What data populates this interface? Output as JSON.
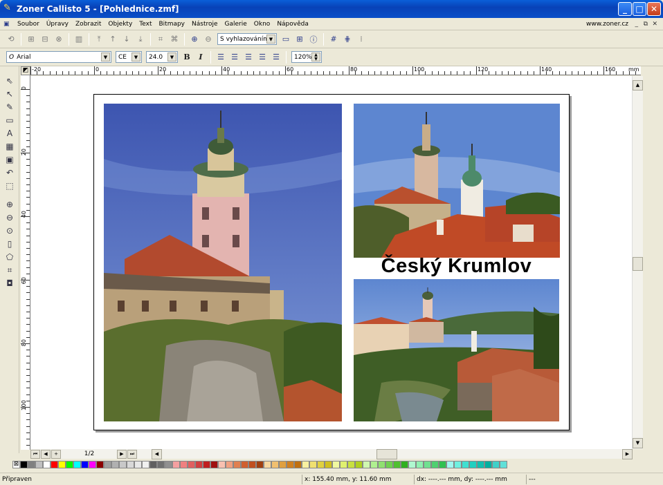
{
  "window": {
    "title": "Zoner Callisto 5 - [Pohlednice.zmf]"
  },
  "menu": {
    "items": [
      "Soubor",
      "Úpravy",
      "Zobrazit",
      "Objekty",
      "Text",
      "Bitmapy",
      "Nástroje",
      "Galerie",
      "Okno",
      "Nápověda"
    ],
    "site": "www.zoner.cz"
  },
  "toolbar": {
    "smoothing": "S vyhlazováním"
  },
  "format": {
    "font": "Arial",
    "charset": "CE",
    "size": "24.0",
    "bold": "B",
    "italic": "I",
    "zoom": "120%"
  },
  "ruler": {
    "h_labels": [
      "-20",
      "0",
      "20",
      "40",
      "60",
      "80",
      "100",
      "120",
      "140",
      "160"
    ],
    "h_unit": "mm",
    "v_labels": [
      "0",
      "20",
      "40",
      "60",
      "80",
      "100"
    ]
  },
  "document": {
    "title_text": "Český Krumlov"
  },
  "pagenav": {
    "page": "1/2"
  },
  "status": {
    "ready": "Připraven",
    "xy": "x: 155.40 mm, y: 11.60 mm",
    "dxdy": "dx: ----.--- mm, dy: ----.--- mm",
    "extra": "---"
  },
  "palette": [
    "#000000",
    "#808080",
    "#c0c0c0",
    "#ffffff",
    "#ff0000",
    "#ffff00",
    "#00ff00",
    "#00ffff",
    "#0000ff",
    "#ff00ff",
    "#8b0000",
    "#a0a0a0",
    "#b0b0b0",
    "#c8c8c8",
    "#d8d8d8",
    "#e8e8e8",
    "#f0f0f0",
    "#606060",
    "#707070",
    "#909090",
    "#f4a0a0",
    "#f08080",
    "#e06060",
    "#d04040",
    "#c02020",
    "#a01010",
    "#f8c0b0",
    "#f0a080",
    "#e08050",
    "#d06030",
    "#c05020",
    "#a04010",
    "#f8d8a0",
    "#f0c070",
    "#e0a040",
    "#d08020",
    "#c07010",
    "#f8f0a0",
    "#f0e070",
    "#e0d040",
    "#d0c020",
    "#f0f8a0",
    "#e0f070",
    "#c8e040",
    "#b0d020",
    "#d0f8b0",
    "#b0f090",
    "#90e070",
    "#70d050",
    "#50c030",
    "#30b020",
    "#b0f8d0",
    "#90f0b0",
    "#70e090",
    "#50d070",
    "#30c050",
    "#a0f8f0",
    "#70f0e0",
    "#40e0d0",
    "#20d0c0",
    "#10c0b0",
    "#00b0a0",
    "#40d0c8",
    "#60e0d8"
  ]
}
